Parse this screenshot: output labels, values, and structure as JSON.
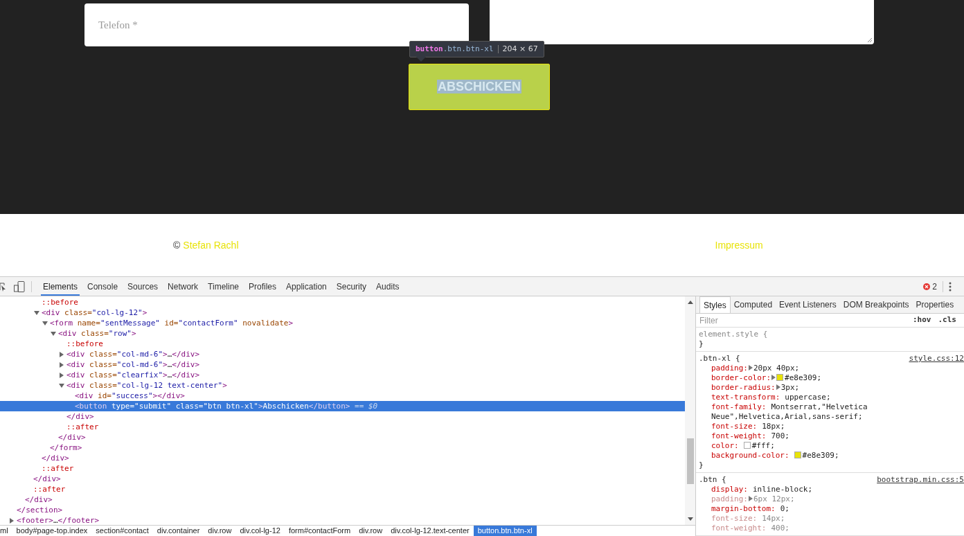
{
  "page": {
    "phone_field": {
      "placeholder": "Telefon *"
    },
    "tooltip": {
      "tag": "button",
      "classes": ".btn.btn-xl",
      "size": "204 × 67"
    },
    "submit_button": {
      "label": "ABSCHICKEN",
      "highlighted": true
    },
    "footer": {
      "copyright": "©",
      "author_link": "Stefan Rachl",
      "imprint_link": "Impressum"
    }
  },
  "devtools": {
    "tabs": [
      {
        "label": "Elements",
        "selected": true
      },
      {
        "label": "Console",
        "selected": false
      },
      {
        "label": "Sources",
        "selected": false
      },
      {
        "label": "Network",
        "selected": false
      },
      {
        "label": "Timeline",
        "selected": false
      },
      {
        "label": "Profiles",
        "selected": false
      },
      {
        "label": "Application",
        "selected": false
      },
      {
        "label": "Security",
        "selected": false
      },
      {
        "label": "Audits",
        "selected": false
      }
    ],
    "error_count": "2",
    "dom_tree": [
      {
        "children": [
          {
            "children": [
              {
                "children": [
                  {
                    "parts": [
                      {
                        "kind": "pseudo",
                        "text": "::before"
                      }
                    ],
                    "selected": false
                  },
                  {
                    "parts": [
                      {
                        "kind": "tag",
                        "text": "<div"
                      },
                      {
                        "kind": "attr",
                        "text": " class="
                      },
                      {
                        "kind": "value",
                        "text": "\"col-lg-12\""
                      },
                      {
                        "kind": "tag",
                        "text": ">"
                      }
                    ],
                    "expanded": true,
                    "selected": false,
                    "children": [
                      {
                        "parts": [
                          {
                            "kind": "tag",
                            "text": "<form"
                          },
                          {
                            "kind": "attr",
                            "text": " name="
                          },
                          {
                            "kind": "value",
                            "text": "\"sentMessage\""
                          },
                          {
                            "kind": "attr",
                            "text": " id="
                          },
                          {
                            "kind": "value",
                            "text": "\"contactForm\""
                          },
                          {
                            "kind": "attr",
                            "text": " novalidate"
                          },
                          {
                            "kind": "tag",
                            "text": ">"
                          }
                        ],
                        "expanded": true,
                        "selected": false,
                        "children": [
                          {
                            "parts": [
                              {
                                "kind": "tag",
                                "text": "<div"
                              },
                              {
                                "kind": "attr",
                                "text": " class="
                              },
                              {
                                "kind": "value",
                                "text": "\"row\""
                              },
                              {
                                "kind": "tag",
                                "text": ">"
                              }
                            ],
                            "expanded": true,
                            "selected": false,
                            "children": [
                              {
                                "parts": [
                                  {
                                    "kind": "pseudo",
                                    "text": "::before"
                                  }
                                ],
                                "selected": false
                              },
                              {
                                "parts": [
                                  {
                                    "kind": "tag",
                                    "text": "<div"
                                  },
                                  {
                                    "kind": "attr",
                                    "text": " class="
                                  },
                                  {
                                    "kind": "value",
                                    "text": "\"col-md-6\""
                                  },
                                  {
                                    "kind": "tag",
                                    "text": ">"
                                  },
                                  {
                                    "kind": "text",
                                    "text": "…"
                                  },
                                  {
                                    "kind": "tag",
                                    "text": "</div>"
                                  }
                                ],
                                "expanded": false,
                                "selected": false
                              },
                              {
                                "parts": [
                                  {
                                    "kind": "tag",
                                    "text": "<div"
                                  },
                                  {
                                    "kind": "attr",
                                    "text": " class="
                                  },
                                  {
                                    "kind": "value",
                                    "text": "\"col-md-6\""
                                  },
                                  {
                                    "kind": "tag",
                                    "text": ">"
                                  },
                                  {
                                    "kind": "text",
                                    "text": "…"
                                  },
                                  {
                                    "kind": "tag",
                                    "text": "</div>"
                                  }
                                ],
                                "expanded": false,
                                "selected": false
                              },
                              {
                                "parts": [
                                  {
                                    "kind": "tag",
                                    "text": "<div"
                                  },
                                  {
                                    "kind": "attr",
                                    "text": " class="
                                  },
                                  {
                                    "kind": "value",
                                    "text": "\"clearfix\""
                                  },
                                  {
                                    "kind": "tag",
                                    "text": ">"
                                  },
                                  {
                                    "kind": "text",
                                    "text": "…"
                                  },
                                  {
                                    "kind": "tag",
                                    "text": "</div>"
                                  }
                                ],
                                "expanded": false,
                                "selected": false
                              },
                              {
                                "parts": [
                                  {
                                    "kind": "tag",
                                    "text": "<div"
                                  },
                                  {
                                    "kind": "attr",
                                    "text": " class="
                                  },
                                  {
                                    "kind": "value",
                                    "text": "\"col-lg-12 text-center\""
                                  },
                                  {
                                    "kind": "tag",
                                    "text": ">"
                                  }
                                ],
                                "expanded": true,
                                "selected": false,
                                "children": [
                                  {
                                    "parts": [
                                      {
                                        "kind": "tag",
                                        "text": "<div"
                                      },
                                      {
                                        "kind": "attr",
                                        "text": " id="
                                      },
                                      {
                                        "kind": "value",
                                        "text": "\"success\""
                                      },
                                      {
                                        "kind": "tag",
                                        "text": "></div>"
                                      }
                                    ],
                                    "selected": false
                                  },
                                  {
                                    "parts": [
                                      {
                                        "kind": "tag",
                                        "text": "<button"
                                      },
                                      {
                                        "kind": "attr",
                                        "text": " type="
                                      },
                                      {
                                        "kind": "value",
                                        "text": "\"submit\""
                                      },
                                      {
                                        "kind": "attr",
                                        "text": " class="
                                      },
                                      {
                                        "kind": "value",
                                        "text": "\"btn btn-xl\""
                                      },
                                      {
                                        "kind": "tag",
                                        "text": ">"
                                      },
                                      {
                                        "kind": "text",
                                        "text": "Abschicken"
                                      },
                                      {
                                        "kind": "tag",
                                        "text": "</button>"
                                      },
                                      {
                                        "kind": "hint",
                                        "text": " == $0"
                                      }
                                    ],
                                    "selected": true
                                  }
                                ],
                                "close": "</div>"
                              },
                              {
                                "parts": [
                                  {
                                    "kind": "pseudo",
                                    "text": "::after"
                                  }
                                ],
                                "selected": false
                              }
                            ],
                            "close": "</div>"
                          }
                        ],
                        "close": "</form>"
                      }
                    ],
                    "close": "</div>"
                  },
                  {
                    "parts": [
                      {
                        "kind": "pseudo",
                        "text": "::after"
                      }
                    ],
                    "selected": false
                  }
                ],
                "close": "</div>"
              },
              {
                "parts": [
                  {
                    "kind": "pseudo",
                    "text": "::after"
                  }
                ],
                "selected": false
              }
            ],
            "close": "</div>"
          }
        ],
        "close": "</section>"
      },
      {
        "parts": [
          {
            "kind": "tag",
            "text": "<footer>"
          },
          {
            "kind": "text",
            "text": "…"
          },
          {
            "kind": "tag",
            "text": "</footer>"
          }
        ],
        "expanded": false,
        "selected": false
      }
    ],
    "breadcrumbs": [
      {
        "label": "ml",
        "selected": false
      },
      {
        "label": "body#page-top.index",
        "selected": false
      },
      {
        "label": "section#contact",
        "selected": false
      },
      {
        "label": "div.container",
        "selected": false
      },
      {
        "label": "div.row",
        "selected": false
      },
      {
        "label": "div.col-lg-12",
        "selected": false
      },
      {
        "label": "form#contactForm",
        "selected": false
      },
      {
        "label": "div.row",
        "selected": false
      },
      {
        "label": "div.col-lg-12.text-center",
        "selected": false
      },
      {
        "label": "button.btn.btn-xl",
        "selected": true
      }
    ],
    "sidebar_tabs": [
      {
        "label": "Styles",
        "selected": true
      },
      {
        "label": "Computed",
        "selected": false
      },
      {
        "label": "Event Listeners",
        "selected": false
      },
      {
        "label": "DOM Breakpoints",
        "selected": false
      },
      {
        "label": "Properties",
        "selected": false
      }
    ],
    "filter": {
      "placeholder": "Filter",
      "hov": ":hov",
      "cls": ".cls"
    },
    "rules": [
      {
        "selector": "element.style {",
        "close": "}",
        "dim": true
      },
      {
        "selector": ".btn-xl {",
        "source": "style.css:12",
        "close": "}",
        "properties": [
          {
            "name": "padding:",
            "value": "20px 40px;",
            "expandable": true,
            "overridden": false
          },
          {
            "name": "border-color:",
            "value": "#e8e309;",
            "expandable": true,
            "color": "#e8e309",
            "overridden": false
          },
          {
            "name": "border-radius:",
            "value": "3px;",
            "expandable": true,
            "overridden": false
          },
          {
            "name": "text-transform:",
            "value": "uppercase;",
            "overridden": false
          },
          {
            "name": "font-family:",
            "value": "Montserrat,\"Helvetica Neue\",Helvetica,Arial,sans-serif;",
            "overridden": false
          },
          {
            "name": "font-size:",
            "value": "18px;",
            "overridden": false
          },
          {
            "name": "font-weight:",
            "value": "700;",
            "overridden": false
          },
          {
            "name": "color:",
            "value": "#fff;",
            "color": "#ffffff",
            "overridden": false
          },
          {
            "name": "background-color:",
            "value": "#e8e309;",
            "color": "#e8e309",
            "overridden": false
          }
        ]
      },
      {
        "selector": ".btn {",
        "source": "bootstrap.min.css:5",
        "properties": [
          {
            "name": "display:",
            "value": "inline-block;",
            "overridden": false
          },
          {
            "name": "padding:",
            "value": "6px 12px;",
            "expandable": true,
            "overridden": true
          },
          {
            "name": "margin-bottom:",
            "value": "0;",
            "overridden": false
          },
          {
            "name": "font-size:",
            "value": "14px;",
            "overridden": true
          },
          {
            "name": "font-weight:",
            "value": "400;",
            "overridden": true
          }
        ]
      }
    ]
  }
}
